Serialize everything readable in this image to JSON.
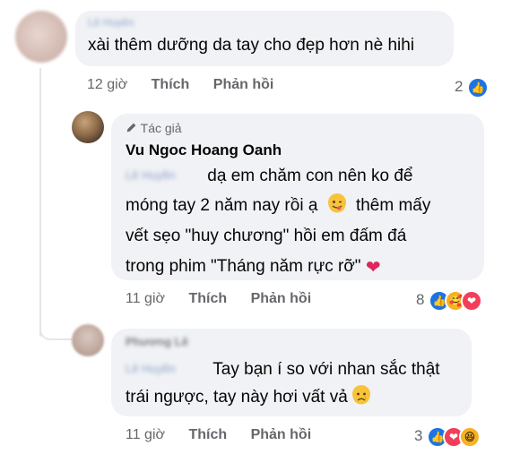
{
  "comment1": {
    "author_blurred": "Lê Huyền",
    "text": "xài thêm dưỡng da tay cho đẹp hơn nè hihi",
    "time": "12 giờ",
    "like_label": "Thích",
    "reply_label": "Phản hồi",
    "reaction_count": "2",
    "reactions": [
      "like-icon"
    ]
  },
  "comment2": {
    "badge_label": "Tác giả",
    "author": "Vu Ngoc Hoang Oanh",
    "mention_blurred": "Lê Huyền",
    "line1": "dạ em chăm con nên ko để",
    "line2a": "móng tay 2 năm nay rồi ạ",
    "line2b": "thêm mấy",
    "line3": "vết sẹo \"huy chương\" hồi em đấm đá",
    "line4": "trong phim \"Tháng năm rực rỡ\"",
    "time": "11 giờ",
    "like_label": "Thích",
    "reply_label": "Phản hồi",
    "reaction_count": "8",
    "reactions": [
      "like-icon",
      "care-icon",
      "love-icon"
    ]
  },
  "comment3": {
    "author_blurred": "Phương Lê",
    "mention_blurred": "Lê Huyền",
    "line1": "Tay bạn í so với nhan sắc thật",
    "line2": "trái ngược, tay này hơi vất vả",
    "time": "11 giờ",
    "like_label": "Thích",
    "reply_label": "Phản hồi",
    "reaction_count": "3",
    "reactions": [
      "like-icon",
      "love-icon",
      "haha-icon"
    ]
  },
  "colors": {
    "bubble": "#f0f2f5",
    "meta_text": "#65676b",
    "like_blue": "#1b74e4",
    "love_red": "#f33e58",
    "emoji_yellow": "#f7b125"
  }
}
